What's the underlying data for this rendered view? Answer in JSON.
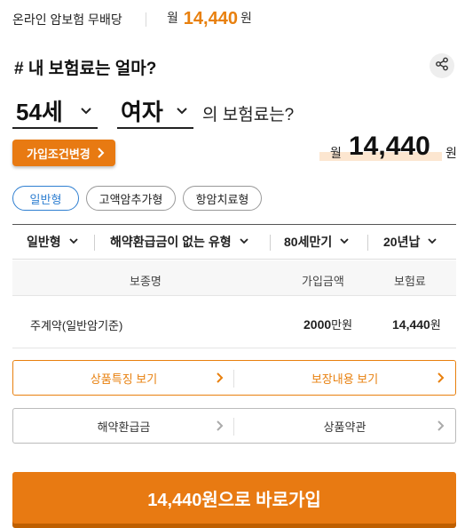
{
  "header": {
    "product_name": "온라인 암보험 무배당",
    "price_prefix": "월",
    "price_value": "14,440",
    "price_unit": "원"
  },
  "question": {
    "title": "# 내 보험료는 얼마?",
    "age": "54세",
    "gender": "여자",
    "suffix": "의 보험료는?"
  },
  "change_button": "가입조건변경",
  "premium": {
    "prefix": "월",
    "value": "14,440",
    "unit": "원"
  },
  "plan_tabs": [
    {
      "label": "일반형",
      "active": true
    },
    {
      "label": "고액암추가형",
      "active": false
    },
    {
      "label": "항암치료형",
      "active": false
    }
  ],
  "filters": [
    "일반형",
    "해약환급금이 없는 유형",
    "80세만기",
    "20년납"
  ],
  "table": {
    "headers": [
      "보종명",
      "가입금액",
      "보험료"
    ],
    "rows": [
      {
        "name": "주계약(일반암기준)",
        "amount": "2000",
        "amount_unit": "만원",
        "premium": "14,440",
        "premium_unit": "원"
      }
    ]
  },
  "links_primary": [
    "상품특징 보기",
    "보장내용 보기"
  ],
  "links_secondary": [
    "해약환급금",
    "상품약관"
  ],
  "join_button": "14,440원으로 바로가입",
  "colors": {
    "accent": "#e87a12",
    "tab_active": "#2f7fd1",
    "highlight": "#fce2c8"
  },
  "icons": {
    "share": "share-icon",
    "dropdown": "chevron-down-icon",
    "link": "chevron-right-icon"
  }
}
